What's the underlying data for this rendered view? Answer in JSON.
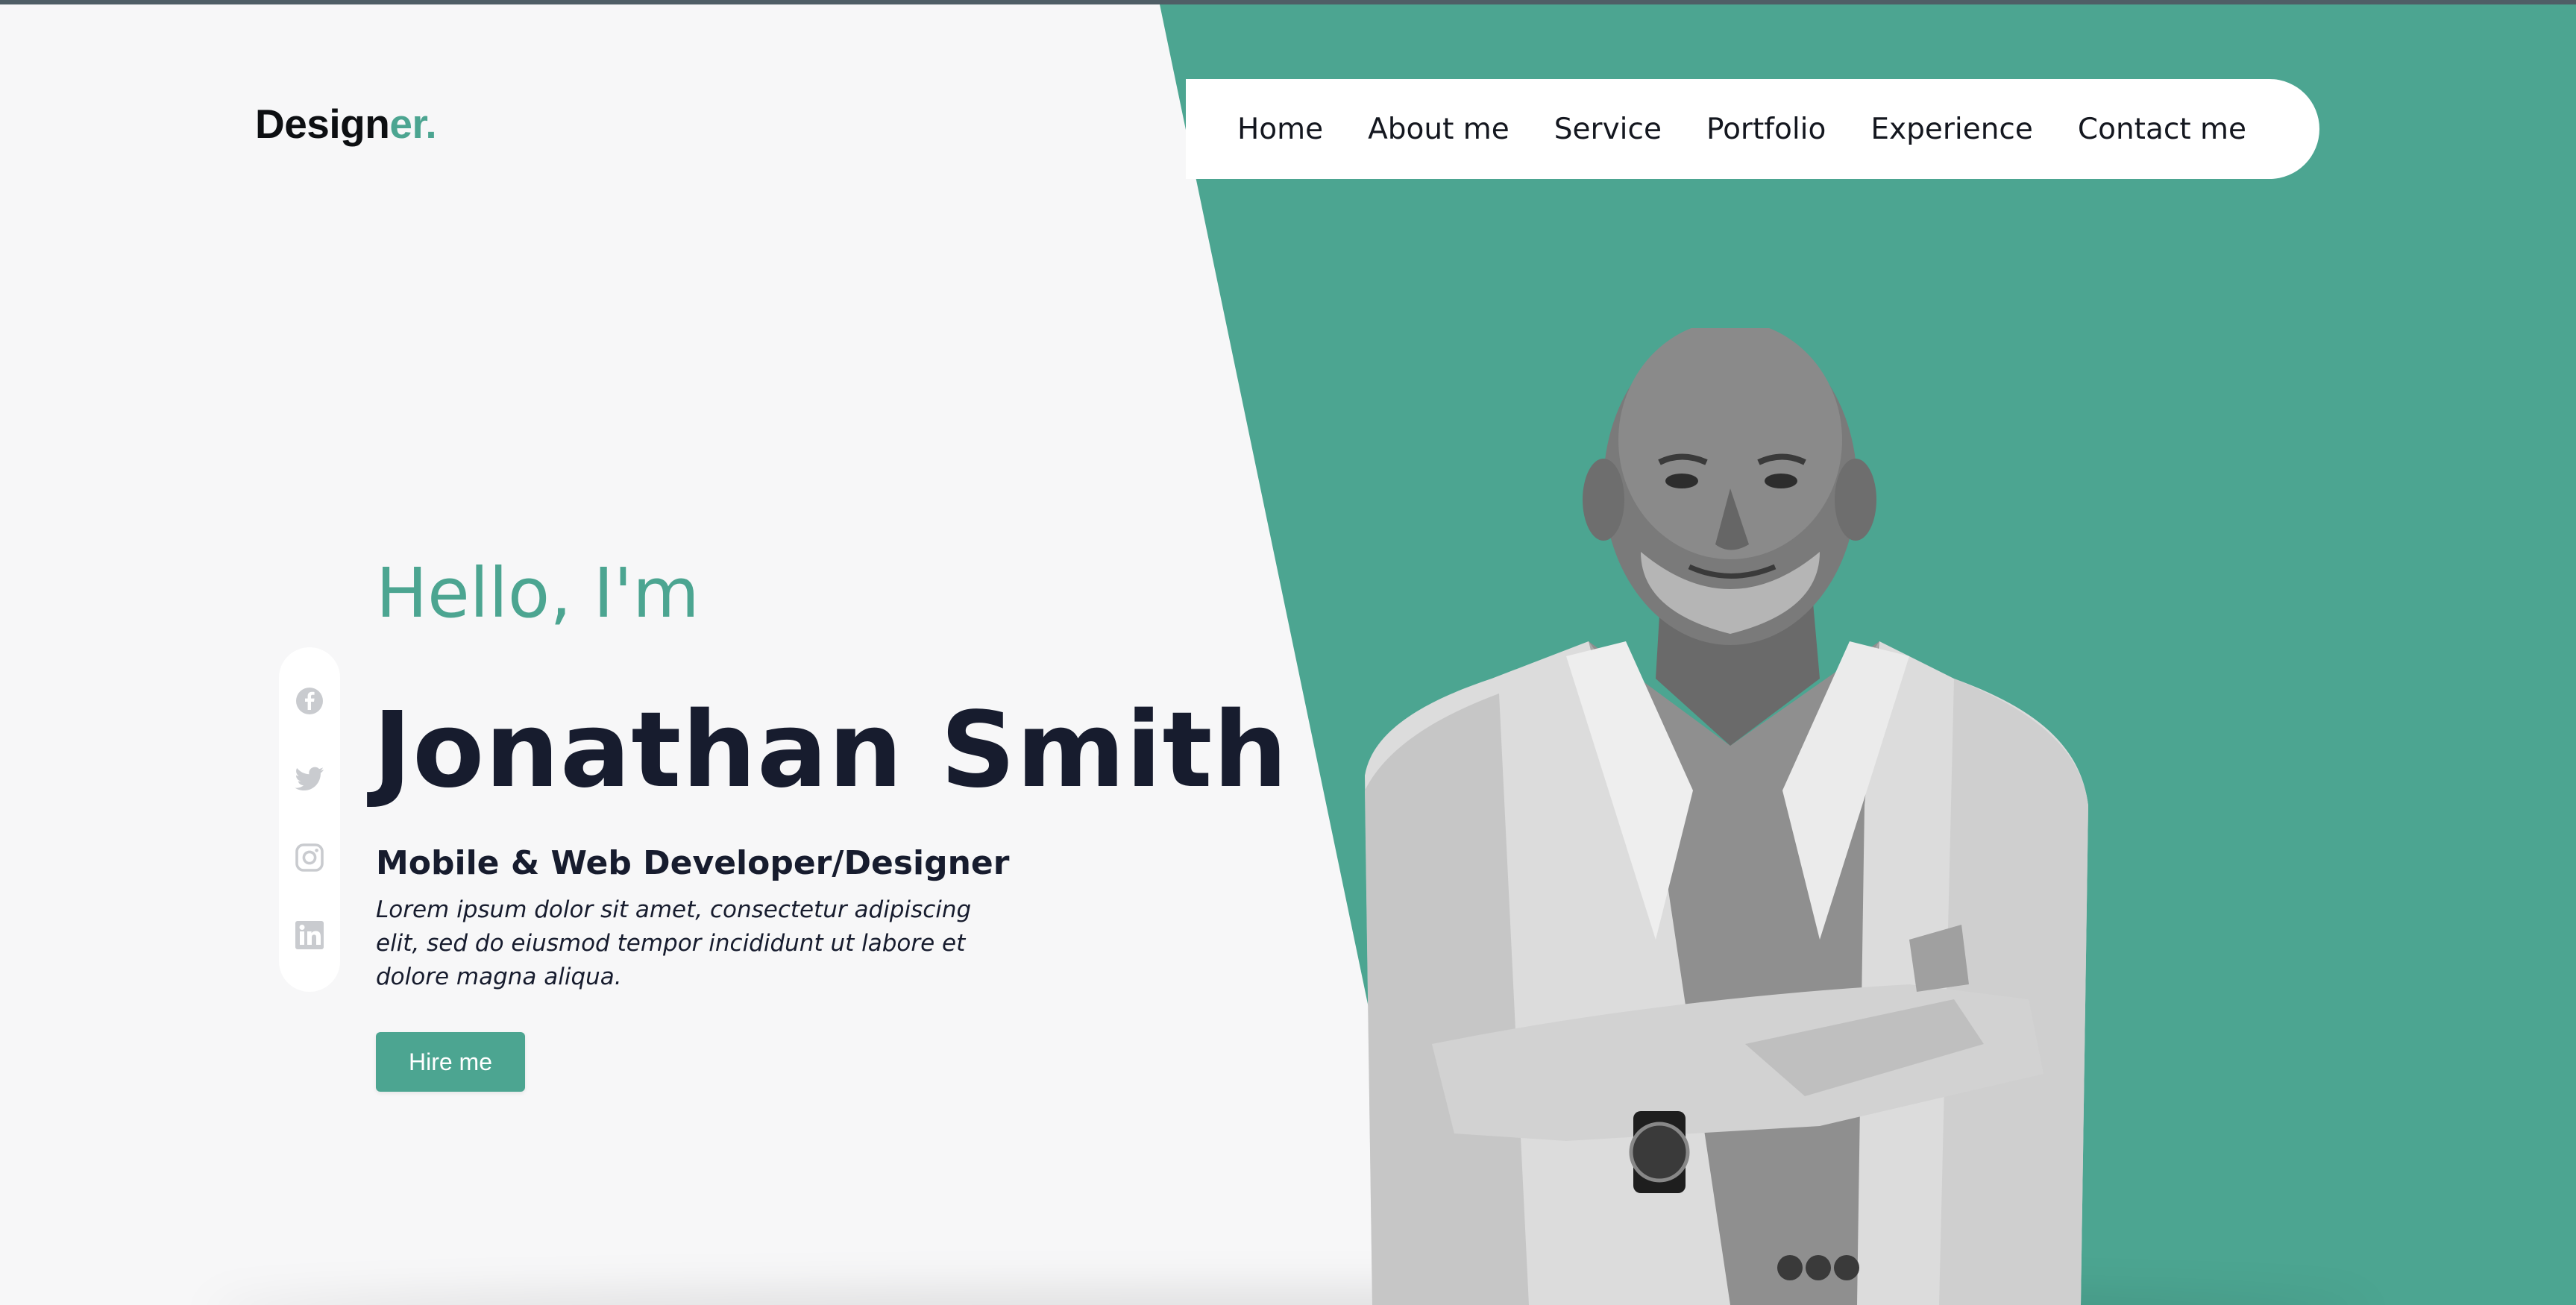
{
  "brand": {
    "logo_main": "Design",
    "logo_accent": "er."
  },
  "nav": {
    "items": [
      {
        "label": "Home"
      },
      {
        "label": "About me"
      },
      {
        "label": "Service"
      },
      {
        "label": "Portfolio"
      },
      {
        "label": "Experience"
      },
      {
        "label": "Contact me"
      }
    ]
  },
  "hero": {
    "greeting": "Hello, I'm",
    "name": "Jonathan Smith",
    "role": "Mobile & Web Developer/Designer",
    "description": "Lorem ipsum dolor sit amet, consectetur adipiscing elit, sed do eiusmod tempor incididunt ut labore et dolore magna aliqua.",
    "cta_label": "Hire me"
  },
  "social": {
    "icons": [
      "facebook-icon",
      "twitter-icon",
      "instagram-icon",
      "linkedin-icon"
    ]
  },
  "colors": {
    "accent": "#4ca591",
    "text_dark": "#171c2e",
    "background": "#f7f7f8",
    "nav_bg": "#ffffff"
  }
}
